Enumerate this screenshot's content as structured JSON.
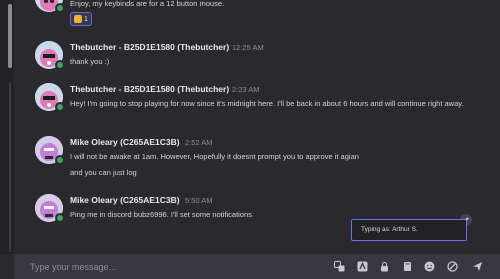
{
  "messages": [
    {
      "text": "Enjoy, my keybinds are for a 12 button mouse.",
      "reaction": {
        "emoji_icon": "thumbs-up-icon",
        "count": "1"
      }
    },
    {
      "author": "Thebutcher - B25D1E1580 (Thebutcher)",
      "time": "12:25 AM",
      "lines": [
        "thank you :)"
      ]
    },
    {
      "author": "Thebutcher - B25D1E1580 (Thebutcher)",
      "time": "2:23 AM",
      "lines": [
        "Hey! I'm going to stop playing for now since it's midnight here. I'll be back in about 6 hours and will continue right away."
      ]
    },
    {
      "author": "Mike Oleary (C265AE1C3B)",
      "time": "2:52 AM",
      "lines": [
        "I will not be awake at 1am. However, Hopefully it doesnt prompt you to approve it agian",
        "and you can just log"
      ]
    },
    {
      "author": "Mike Oleary (C265AE1C3B)",
      "time": "5:50 AM",
      "lines": [
        "Ping me in discord bubz6996. I'll set some notifications"
      ]
    }
  ],
  "typing_indicator": "Typing as: Arthur S.",
  "composer": {
    "placeholder": "Type your message...",
    "icons": [
      "translate-icon",
      "translate-alt-icon",
      "lock-icon",
      "book-icon",
      "emoji-icon",
      "blocked-icon",
      "send-icon"
    ]
  },
  "colors": {
    "accent": "#5865f2",
    "online": "#3ba55c",
    "background": "#2a2a2e"
  }
}
